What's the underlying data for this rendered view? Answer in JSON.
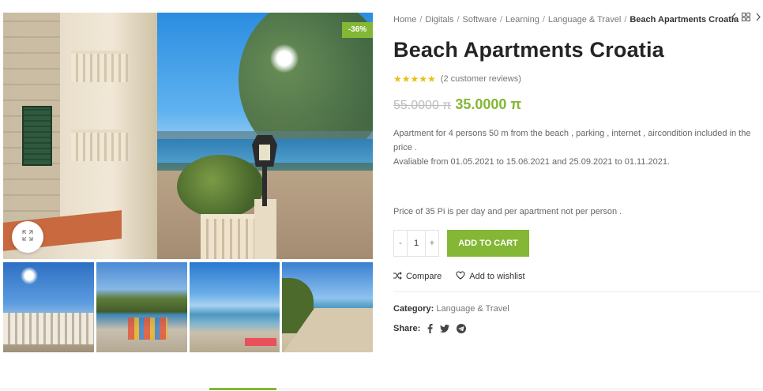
{
  "gallery": {
    "discount_badge": "-36%",
    "zoom_icon": "expand-icon",
    "thumbnails": [
      "balcony-sea-view",
      "beach-umbrellas",
      "pebble-beach",
      "shoreline"
    ]
  },
  "breadcrumbs": {
    "items": [
      "Home",
      "Digitals",
      "Software",
      "Learning",
      "Language & Travel"
    ],
    "separator": "/",
    "current": "Beach Apartments Croatia",
    "nav_icons": [
      "chevron-left-icon",
      "grid-icon",
      "chevron-right-icon"
    ]
  },
  "product": {
    "title": "Beach Apartments Croatia",
    "rating": 5,
    "reviews_text": "(2 customer reviews)",
    "old_price": "55.0000 π",
    "new_price": "35.0000 π",
    "description_line1": "Apartment for 4 persons 50 m from the beach , parking , internet , aircondition included in the price .",
    "description_line2": "Avaliable from 01.05.2021 to 15.06.2021 and 25.09.2021 to 01.11.2021.",
    "price_note": "Price of 35 Pi  is per day  and per apartment not per person ."
  },
  "cart": {
    "minus": "-",
    "quantity": "1",
    "plus": "+",
    "add_to_cart": "ADD TO CART"
  },
  "actions": {
    "compare": "Compare",
    "wishlist": "Add to wishlist"
  },
  "meta": {
    "category_label": "Category:",
    "category_value": "Language & Travel",
    "share_label": "Share:",
    "share_icons": [
      "facebook-icon",
      "twitter-icon",
      "telegram-icon"
    ]
  },
  "colors": {
    "accent": "#83b735",
    "star": "#eabe12"
  }
}
